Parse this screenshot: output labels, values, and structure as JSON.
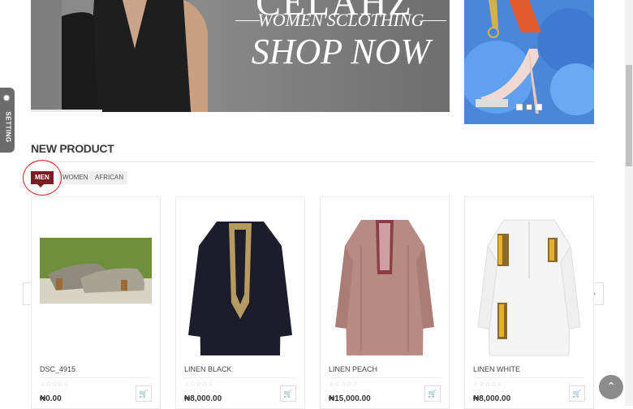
{
  "hero": {
    "brand": "CELAHZ",
    "subtitle": "WOMEN'SCLOTHING",
    "cta": "SHOP NOW"
  },
  "side_banner": {
    "dots": 3,
    "active_dot": 2
  },
  "setting_tab": {
    "label": "SETTING",
    "icon": "gear-icon"
  },
  "section": {
    "title": "NEW PRODUCT"
  },
  "tabs": [
    {
      "label": "MEN",
      "active": true
    },
    {
      "label": "WOMEN",
      "active": false
    },
    {
      "label": "AFRICAN",
      "active": false
    }
  ],
  "carousel": {
    "prev_icon": "chevron-left-icon",
    "next_icon": "chevron-right-icon"
  },
  "products": [
    {
      "name": "DSC_4915",
      "price": "₦0.00",
      "stars": "☆☆☆☆☆",
      "cart_icon": "cart-icon"
    },
    {
      "name": "LINEN BLACK",
      "price": "₦8,000.00",
      "stars": "☆☆☆☆☆",
      "cart_icon": "cart-icon"
    },
    {
      "name": "LINEN PEACH",
      "price": "₦15,000.00",
      "stars": "☆☆☆☆☆",
      "cart_icon": "cart-icon"
    },
    {
      "name": "LINEN WHITE",
      "price": "₦8,000.00",
      "stars": "☆☆☆☆☆",
      "cart_icon": "cart-icon"
    }
  ],
  "scroll_top_icon": "arrow-up-icon",
  "colors": {
    "accent": "#7a1e24",
    "highlight_circle": "#d81e1e",
    "banner_blue": "#4a87d8"
  }
}
